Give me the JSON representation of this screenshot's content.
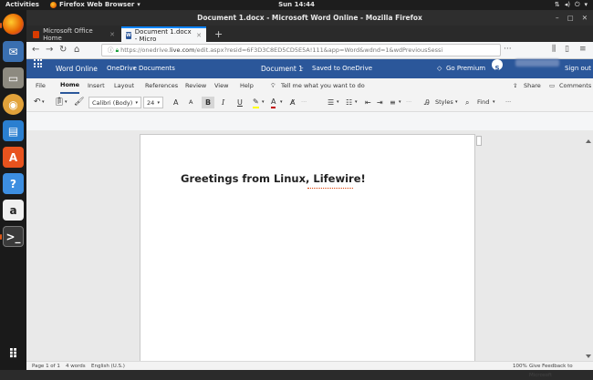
{
  "topbar": {
    "activities": "Activities",
    "app_name": "Firefox Web Browser",
    "clock": "Sun 14:44"
  },
  "window": {
    "title": "Document 1.docx - Microsoft Word Online - Mozilla Firefox"
  },
  "tabs": [
    {
      "label": "Microsoft Office Home"
    },
    {
      "label": "Document 1.docx - Micro"
    }
  ],
  "address_bar": {
    "url_prefix": "https://onedrive.",
    "url_domain": "live.com",
    "url_rest": "/edit.aspx?resid=6F3D3C8ED5CD5E5A!111&app=Word&wdnd=1&wdPreviousSessi"
  },
  "word_header": {
    "app_name": "Word Online",
    "breadcrumb_onedrive": "OneDrive",
    "breadcrumb_sep": "›",
    "breadcrumb_documents": "Documents",
    "doc_name": "Document 1",
    "save_status": "Saved to OneDrive",
    "premium": "Go Premium",
    "signout": "Sign out"
  },
  "ribbon_tabs": [
    "File",
    "Home",
    "Insert",
    "Layout",
    "References",
    "Review",
    "View",
    "Help"
  ],
  "tell_me": "Tell me what you want to do",
  "share": "Share",
  "comments": "Comments",
  "toolbar": {
    "font_name": "Calibri (Body)",
    "font_size": "24",
    "grow_font": "A",
    "shrink_font": "A",
    "bold": "B",
    "italic": "I",
    "underline": "U",
    "styles": "Styles",
    "find": "Find",
    "more": "···"
  },
  "document": {
    "text": "Greetings from Linux, Lifewire!"
  },
  "status_bar": {
    "page": "Page 1 of 1",
    "words": "4 words",
    "language": "English (U.S.)",
    "zoom": "100%",
    "feedback": "Give Feedback to Microsoft"
  },
  "colors": {
    "word_blue": "#2b579a",
    "highlight": "#ffff00",
    "font_color": "#c00000"
  }
}
